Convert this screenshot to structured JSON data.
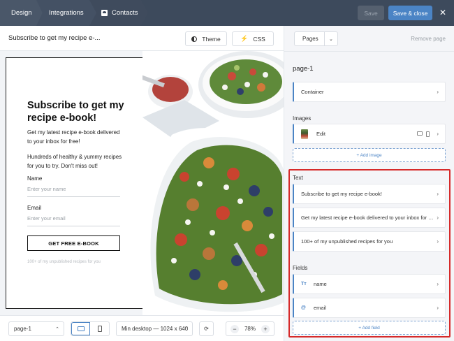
{
  "nav": {
    "breadcrumbs": [
      "Design",
      "Integrations",
      "Contacts"
    ],
    "save_label": "Save",
    "save_close_label": "Save & close",
    "close_glyph": "✕"
  },
  "editor": {
    "doc_title": "Subscribe to get my recipe e-...",
    "theme_label": "Theme",
    "css_label": "CSS"
  },
  "form": {
    "title": "Subscribe to get my recipe e-book!",
    "paragraph1": "Get my latest recipe e-book delivered to your inbox for free!",
    "paragraph2": "Hundreds of healthy & yummy recipes for you to try. Don't miss out!",
    "name_label": "Name",
    "name_placeholder": "Enter your name",
    "email_label": "Email",
    "email_placeholder": "Enter your email",
    "cta_label": "GET FREE E-BOOK",
    "fineprint": "100+ of my unpublished recipes for you"
  },
  "bottom": {
    "page_select": "page-1",
    "mode_select": "Min desktop — 1024 x 640",
    "zoom": "78%",
    "zoom_minus": "−",
    "zoom_plus": "+"
  },
  "panel": {
    "pages_label": "Pages",
    "remove_label": "Remove page",
    "page_name": "page-1",
    "container_label": "Container",
    "images_label": "Images",
    "image_edit_label": "Edit",
    "add_image_label": "+ Add image",
    "text_label": "Text",
    "text_items": [
      "Subscribe to get my recipe e-book!",
      "Get my latest recipe e-book delivered to your inbox for f...",
      "100+ of my unpublished recipes for you"
    ],
    "fields_label": "Fields",
    "fields": [
      {
        "icon": "Tт",
        "label": "name"
      },
      {
        "icon": "@",
        "label": "email"
      }
    ],
    "add_field_label": "+ Add field"
  },
  "colors": {
    "topbar": "#3d4a5c",
    "accent": "#4b84c5",
    "highlight": "#d62a2a"
  }
}
